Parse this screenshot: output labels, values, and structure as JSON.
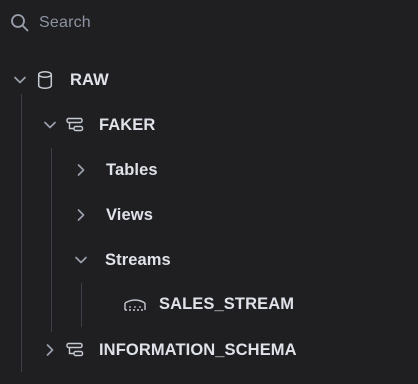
{
  "search": {
    "placeholder": "Search",
    "icon": "search-icon"
  },
  "tree": {
    "database": {
      "label": "RAW",
      "icon": "database-icon",
      "expanded": true
    },
    "schemas": [
      {
        "label": "FAKER",
        "icon": "schema-icon",
        "expanded": true,
        "folders": [
          {
            "label": "Tables",
            "expanded": false
          },
          {
            "label": "Views",
            "expanded": false
          },
          {
            "label": "Streams",
            "expanded": true,
            "items": [
              {
                "label": "SALES_STREAM",
                "icon": "stream-icon"
              }
            ]
          }
        ]
      },
      {
        "label": "INFORMATION_SCHEMA",
        "icon": "schema-icon",
        "expanded": false
      }
    ]
  },
  "colors": {
    "background": "#1f1f22",
    "text": "#dfe2e8",
    "muted": "#8d93a0",
    "guide": "#3c3f47"
  }
}
